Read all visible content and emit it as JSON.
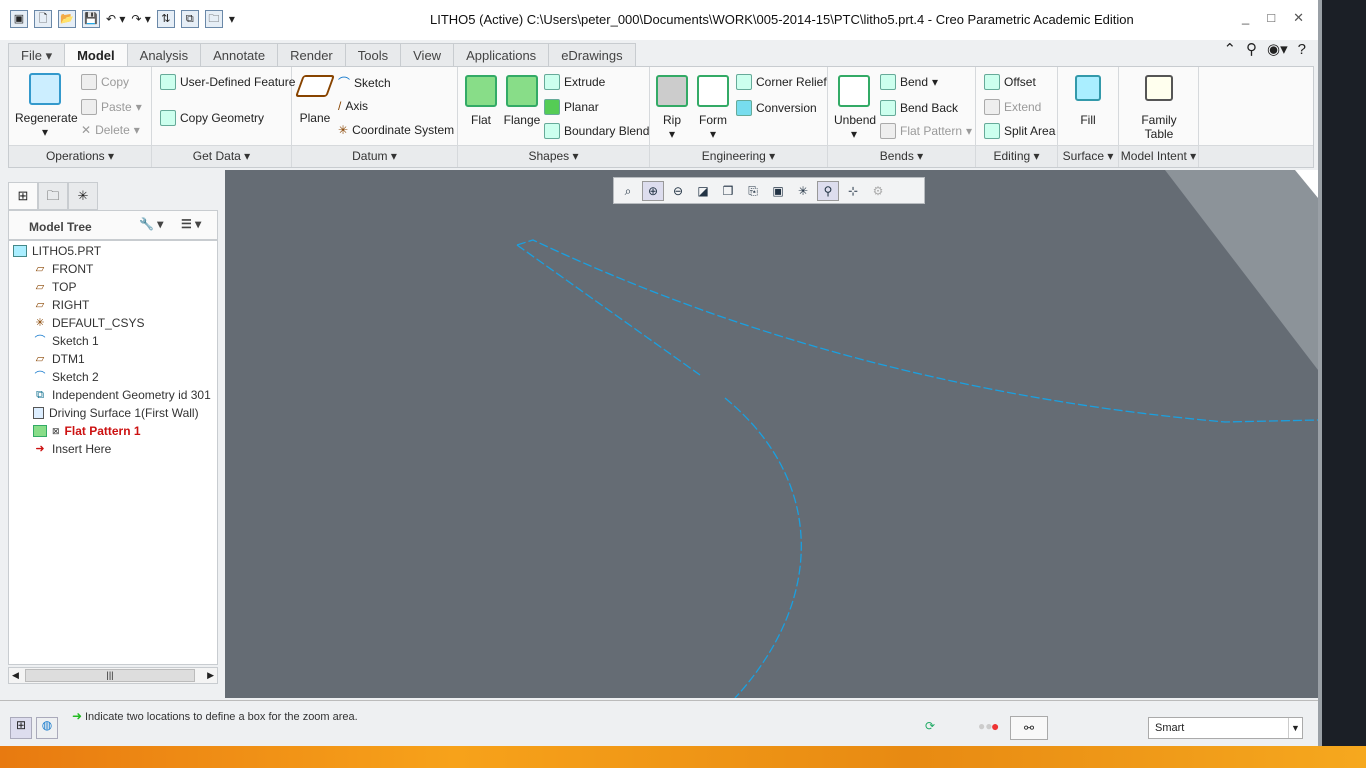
{
  "window": {
    "title": "LITHO5 (Active) C:\\Users\\peter_000\\Documents\\WORK\\005-2014-15\\PTC\\litho5.prt.4 - Creo Parametric Academic Edition"
  },
  "tabs": [
    "File",
    "Model",
    "Analysis",
    "Annotate",
    "Render",
    "Tools",
    "View",
    "Applications",
    "eDrawings"
  ],
  "groups": {
    "operations": {
      "label": "Operations",
      "regenerate": "Regenerate",
      "copy": "Copy",
      "paste": "Paste",
      "delete": "Delete"
    },
    "get_data": {
      "label": "Get Data",
      "udf": "User-Defined Feature",
      "copy_geometry": "Copy Geometry"
    },
    "datum": {
      "label": "Datum",
      "plane": "Plane",
      "sketch": "Sketch",
      "axis": "Axis",
      "csys": "Coordinate System"
    },
    "shapes": {
      "label": "Shapes",
      "flat": "Flat",
      "flange": "Flange",
      "extrude": "Extrude",
      "planar": "Planar",
      "boundary_blend": "Boundary Blend"
    },
    "engineering": {
      "label": "Engineering",
      "rip": "Rip",
      "form": "Form",
      "corner_relief": "Corner Relief",
      "conversion": "Conversion"
    },
    "bends": {
      "label": "Bends",
      "unbend": "Unbend",
      "bend": "Bend",
      "bend_back": "Bend Back",
      "flat_pattern": "Flat Pattern"
    },
    "editing": {
      "label": "Editing",
      "offset": "Offset",
      "extend": "Extend",
      "split_area": "Split Area"
    },
    "surface": {
      "label": "Surface",
      "fill": "Fill"
    },
    "model_intent": {
      "label": "Model Intent",
      "family_table": "Family Table"
    }
  },
  "model_tree": {
    "title": "Model Tree",
    "items": [
      {
        "label": "LITHO5.PRT",
        "icon": "part-icon"
      },
      {
        "label": "FRONT",
        "icon": "datum-plane-icon"
      },
      {
        "label": "TOP",
        "icon": "datum-plane-icon"
      },
      {
        "label": "RIGHT",
        "icon": "datum-plane-icon"
      },
      {
        "label": "DEFAULT_CSYS",
        "icon": "csys-icon"
      },
      {
        "label": "Sketch 1",
        "icon": "sketch-icon"
      },
      {
        "label": "DTM1",
        "icon": "datum-plane-icon"
      },
      {
        "label": "Sketch 2",
        "icon": "sketch-icon"
      },
      {
        "label": "Independent Geometry id 301",
        "icon": "independent-geometry-icon"
      },
      {
        "label": "Driving Surface 1(First Wall)",
        "icon": "surface-icon"
      },
      {
        "label": "Flat Pattern 1",
        "icon": "flat-pattern-icon"
      },
      {
        "label": "Insert Here",
        "icon": "insert-arrow-icon"
      }
    ]
  },
  "status": {
    "message": "Indicate two locations to define a box for the zoom area.",
    "filter": "Smart"
  },
  "colors": {
    "viewport": "#656c74",
    "curve": "#1aa0e0",
    "error_item": "#cc1111"
  }
}
